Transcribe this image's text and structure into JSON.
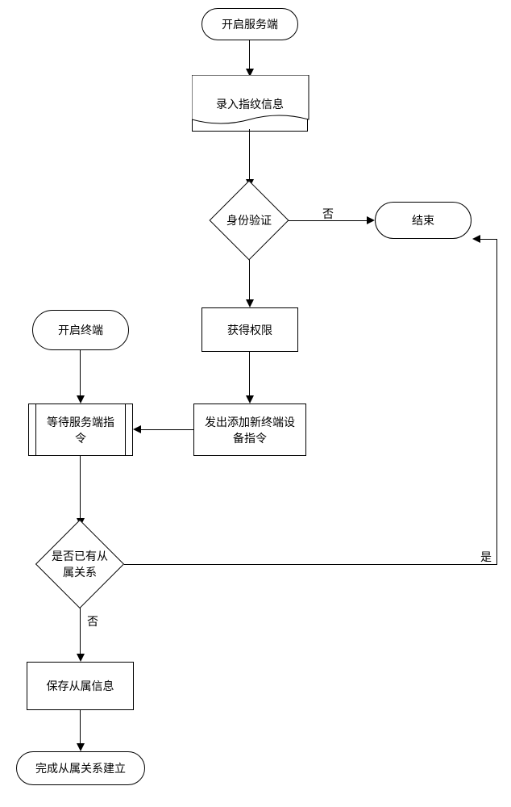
{
  "nodes": {
    "start_server": "开启服务端",
    "input_fingerprint": "录入指纹信息",
    "identity_verify": "身份验证",
    "end": "结束",
    "get_permission": "获得权限",
    "open_terminal": "开启终端",
    "send_add_terminal_cmd": "发出添加新终端设备指令",
    "wait_server_cmd": "等待服务端指令",
    "has_subordinate": "是否已有从属关系",
    "save_subordinate": "保存从属信息",
    "complete_relation": "完成从属关系建立"
  },
  "labels": {
    "no1": "否",
    "yes1": "是",
    "no2": "否"
  }
}
